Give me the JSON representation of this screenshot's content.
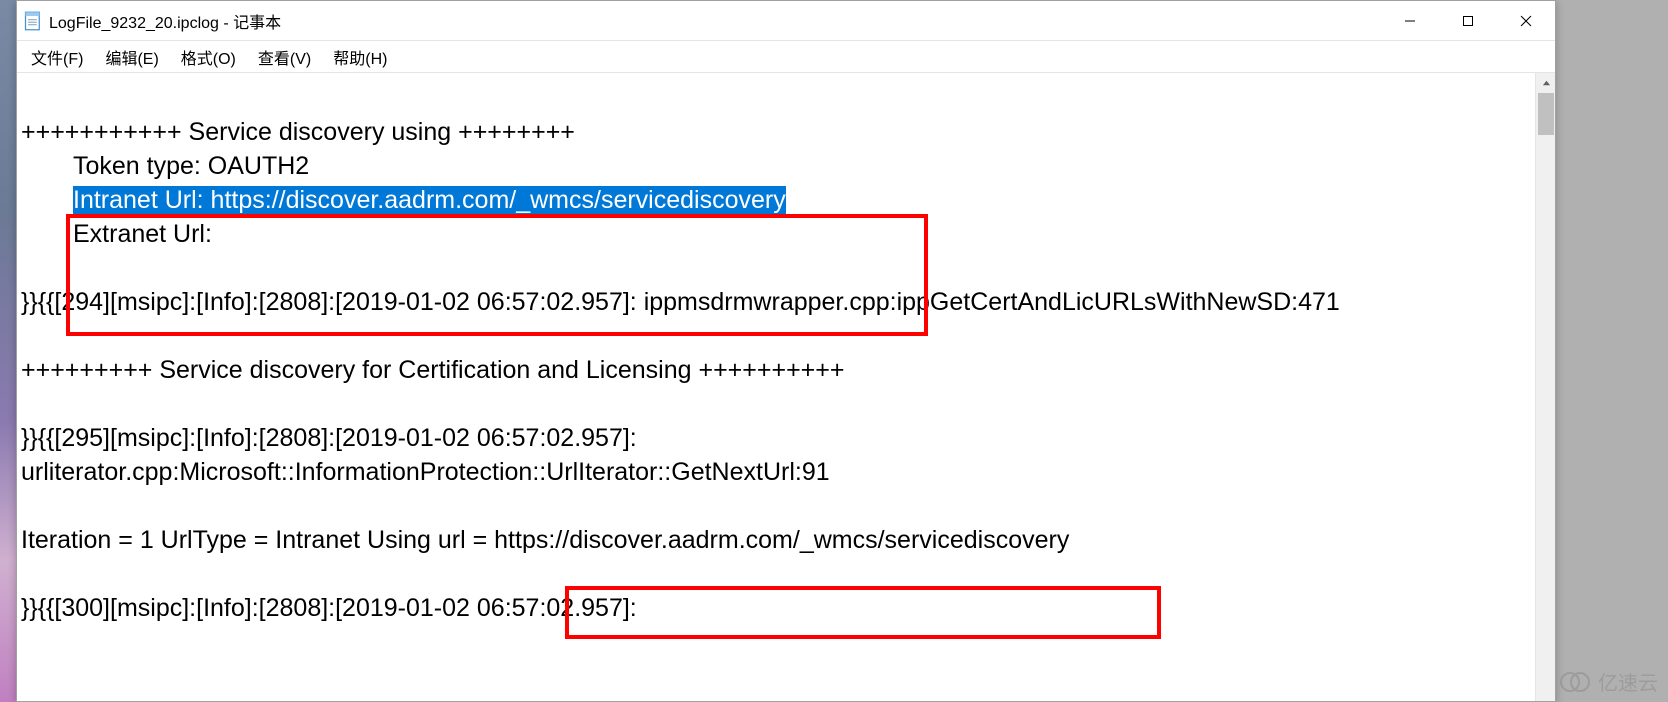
{
  "window": {
    "title": "LogFile_9232_20.ipclog - 记事本"
  },
  "menubar": {
    "file": "文件(F)",
    "edit": "编辑(E)",
    "format": "格式(O)",
    "view": "查看(V)",
    "help": "帮助(H)"
  },
  "content": {
    "line1": "",
    "line2": "+++++++++++ Service discovery using ++++++++",
    "line3": "Token type: OAUTH2",
    "line4_prefix": "",
    "line4_selected": "Intranet Url: https://discover.aadrm.com/_wmcs/servicediscovery",
    "line5": "Extranet Url: ",
    "line6": "",
    "line7": "}}{{[294][msipc]:[Info]:[2808]:[2019-01-02 06:57:02.957]: ippmsdrmwrapper.cpp:ippGetCertAndLicURLsWithNewSD:471",
    "line8": "",
    "line9": "+++++++++ Service discovery for Certification and Licensing ++++++++++",
    "line10": "",
    "line11": "}}{{[295][msipc]:[Info]:[2808]:[2019-01-02 06:57:02.957]: ",
    "line12": "urliterator.cpp:Microsoft::InformationProtection::UrlIterator::GetNextUrl:91",
    "line13": "",
    "line14": "Iteration = 1 UrlType = Intranet Using url = https://discover.aadrm.com/_wmcs/servicediscovery",
    "line15": "",
    "line16": "}}{{[300][msipc]:[Info]:[2808]:[2019-01-02 06:57:02.957]: "
  },
  "watermark": {
    "text": "亿速云"
  }
}
